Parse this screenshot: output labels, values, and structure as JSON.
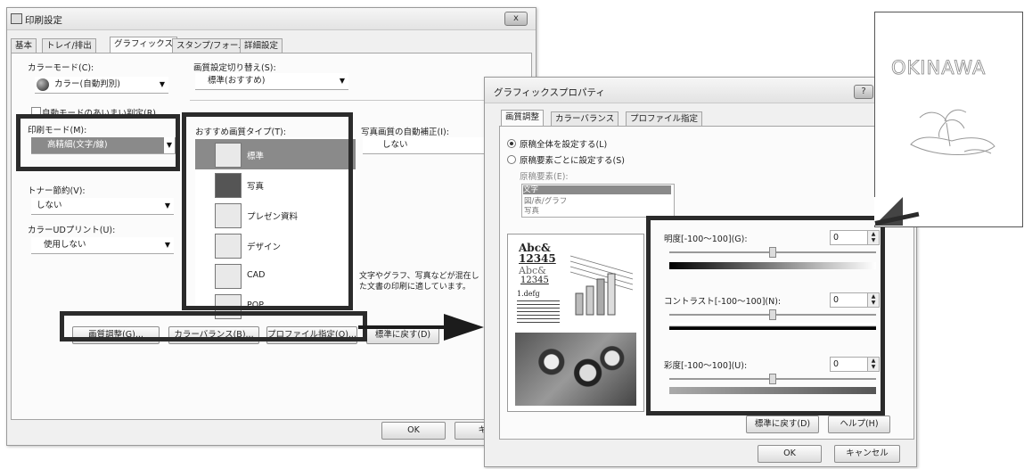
{
  "main_dialog": {
    "title": "印刷設定",
    "close_label": "x",
    "tabs": [
      "基本",
      "トレイ/排出",
      "グラフィックス",
      "スタンプ/フォーム",
      "詳細設定"
    ],
    "color_mode": {
      "label": "カラーモード(C):",
      "value": "カラー(自動判別)"
    },
    "quality_switch": {
      "label": "画質設定切り替え(S):",
      "value": "標準(おすすめ)"
    },
    "auto_mode_checkbox": "自動モードのあいまい判定(R)",
    "print_mode": {
      "label": "印刷モード(M):",
      "value": "高精細(文字/線)"
    },
    "toner_save": {
      "label": "トナー節約(V):",
      "value": "しない"
    },
    "color_ud": {
      "label": "カラーUDプリント(U):",
      "value": "使用しない"
    },
    "image_type": {
      "label": "おすすめ画質タイプ(T):",
      "items": [
        "標準",
        "写真",
        "プレゼン資料",
        "デザイン",
        "CAD",
        "POP"
      ],
      "selected": "標準"
    },
    "photo_correction": {
      "label": "写真画質の自動補正(I):",
      "value": "しない"
    },
    "description": [
      "文字やグラフ、写真などが混在し",
      "た文書の印刷に適しています。"
    ],
    "bottom_buttons": [
      "画質調整(G)...",
      "カラーバランス(B)...",
      "プロファイル指定(O)...",
      "標準に戻す(D)"
    ],
    "ok_label": "OK",
    "cancel_label": "キャ"
  },
  "graphics_dialog": {
    "title": "グラフィックスプロパティ",
    "help_icon": "?",
    "tabs": [
      "画質調整",
      "カラーバランス",
      "プロファイル指定"
    ],
    "radio_all": "原稿全体を設定する(L)",
    "radio_each": "原稿要素ごとに設定する(S)",
    "element_label": "原稿要素(E):",
    "elements": [
      "文字",
      "図/表/グラフ",
      "写真"
    ],
    "preview": {
      "abc1": "Abc&",
      "num1": "12345",
      "abc2": "Abc&",
      "num2": "12345",
      "small": "1.defg"
    },
    "brightness": {
      "label": "明度[-100～100](G):",
      "value": "0"
    },
    "contrast": {
      "label": "コントラスト[-100～100](N):",
      "value": "0"
    },
    "saturation": {
      "label": "彩度[-100～100](U):",
      "value": "0"
    },
    "reset_label": "標準に戻す(D)",
    "help_label": "ヘルプ(H)",
    "ok_label": "OK",
    "cancel_label": "キャンセル"
  },
  "output_page": {
    "text": "OKINAWA"
  }
}
